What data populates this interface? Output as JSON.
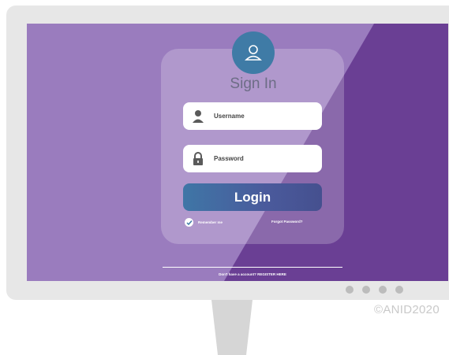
{
  "signin": {
    "title": "Sign In",
    "username_placeholder": "Username",
    "password_placeholder": "Password",
    "login_label": "Login",
    "remember_label": "Remember me",
    "forgot_label": "Forgot Password?",
    "signup_text": "Don't have a account? REGISTER HERE"
  },
  "watermark": "©ANID2020",
  "colors": {
    "screen_light": "#9a7cbe",
    "screen_dark": "#6a3f94",
    "avatar": "#3f7ba6",
    "login_button": "#45508f",
    "frame": "#e7e7e7"
  },
  "icons": [
    "user-icon",
    "person-icon",
    "lock-icon",
    "check-icon"
  ]
}
